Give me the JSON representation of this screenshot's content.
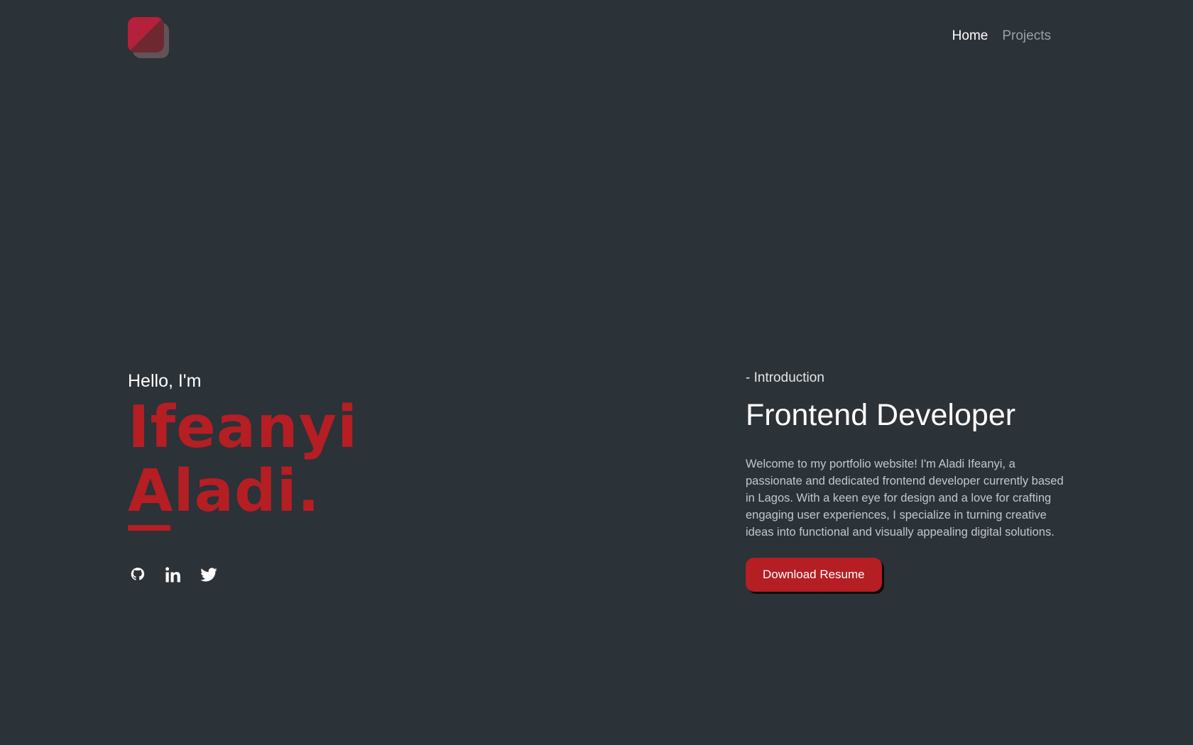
{
  "header": {
    "nav": [
      {
        "label": "Home"
      },
      {
        "label": "Projects"
      }
    ]
  },
  "hero": {
    "greeting": "Hello, I'm",
    "first_name": "Ifeanyi",
    "last_name": "Aladi.",
    "socials": [
      "github-icon",
      "linkedin-icon",
      "twitter-icon"
    ]
  },
  "intro": {
    "label": "- Introduction",
    "role": "Frontend Developer",
    "bio": "Welcome to my portfolio website! I'm Aladi Ifeanyi, a passionate and dedicated frontend developer currently based in Lagos. With a keen eye for design and a love for crafting engaging user experiences, I specialize in turning creative ideas into functional and visually appealing digital solutions.",
    "button_label": "Download Resume"
  },
  "colors": {
    "background": "#2b3238",
    "accent": "#b51e23",
    "muted_nav": "#9aa0a6"
  }
}
